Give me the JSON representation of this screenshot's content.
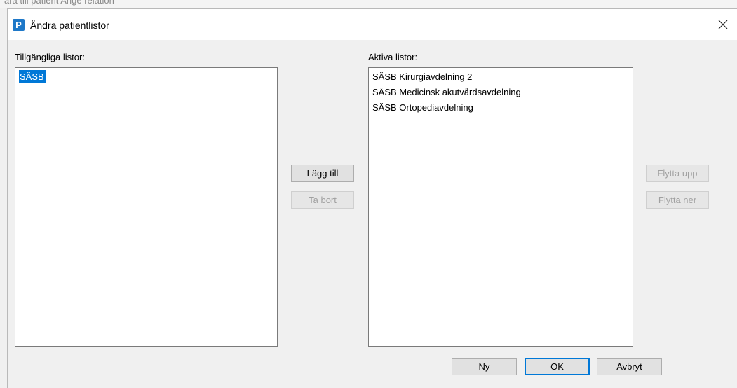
{
  "background": {
    "text": "ara till patient    Ange relation"
  },
  "dialog": {
    "title": "Ändra patientlistor",
    "app_icon_letter": "P",
    "close_glyph": "×"
  },
  "available": {
    "label": "Tillgängliga listor:",
    "items": [
      "SÄSB"
    ],
    "selected_index": 0
  },
  "active": {
    "label": "Aktiva listor:",
    "items": [
      "SÄSB Kirurgiavdelning 2",
      "SÄSB Medicinsk akutvårdsavdelning",
      "SÄSB Ortopediavdelning"
    ]
  },
  "buttons": {
    "add": "Lägg till",
    "remove": "Ta bort",
    "move_up": "Flytta upp",
    "move_down": "Flytta ner",
    "new": "Ny",
    "ok": "OK",
    "cancel": "Avbryt"
  },
  "colors": {
    "selection": "#0078d7",
    "app_icon": "#1e78c8",
    "disabled_text": "#a0a0a0"
  }
}
